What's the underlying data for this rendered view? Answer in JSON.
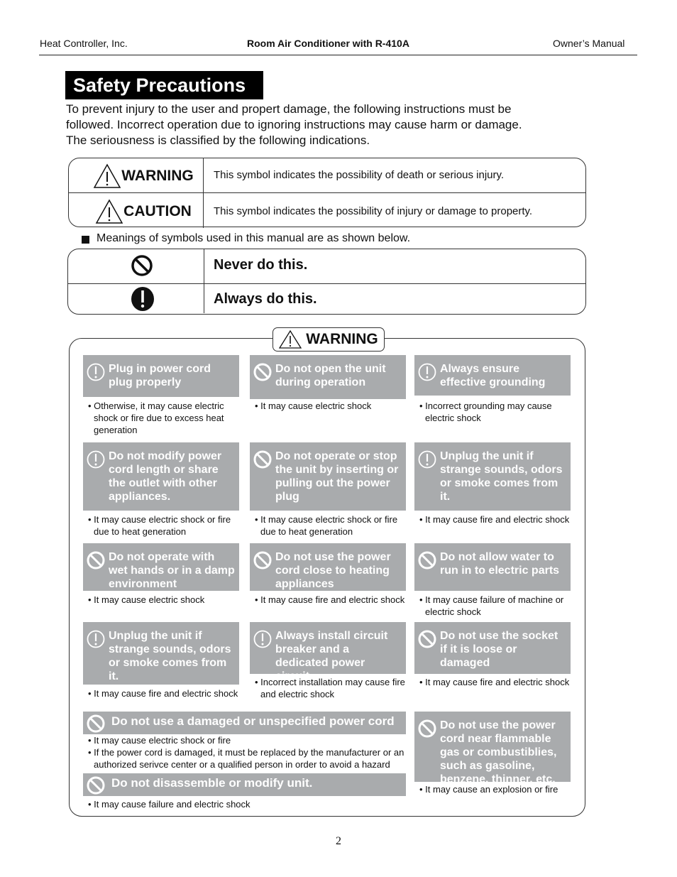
{
  "header": {
    "left": "Heat Controller, Inc.",
    "center": "Room Air Conditioner with R-410A",
    "right": "Owner’s Manual"
  },
  "title": "Safety Precautions",
  "intro": [
    "To prevent injury to the user and propert damage, the following instructions must be",
    "followed. Incorrect operation due to ignoring instructions may cause harm or damage.",
    "The seriousness is classified by the following indications."
  ],
  "severity_table": [
    {
      "icon": "warning-triangle-icon",
      "label": "WARNING",
      "description": "This symbol indicates the possibility of death or serious injury."
    },
    {
      "icon": "warning-triangle-icon",
      "label": "CAUTION",
      "description": "This symbol indicates the possibility of injury or damage to property."
    }
  ],
  "symbols_note": "Meanings of symbols used in this manual are as shown below.",
  "symbols_table": [
    {
      "icon": "prohibited-icon",
      "meaning": "Never do this."
    },
    {
      "icon": "mandatory-icon",
      "meaning": "Always do this."
    }
  ],
  "warning_section": {
    "badge": "WARNING",
    "cards": [
      {
        "icon": "mandatory",
        "title": "Plug in power cord plug properly",
        "notes": [
          "Otherwise, it may cause electric shock or fire due to excess heat generation"
        ]
      },
      {
        "icon": "prohibited",
        "title": "Do not open the unit during operation",
        "notes": [
          "It may cause electric shock"
        ]
      },
      {
        "icon": "mandatory",
        "title": "Always ensure effective grounding",
        "notes": [
          "Incorrect grounding may cause electric shock"
        ]
      },
      {
        "icon": "mandatory",
        "title": "Do not modify power cord length or share the outlet with other appliances.",
        "notes": [
          "It may cause electric shock or fire due to heat generation"
        ]
      },
      {
        "icon": "prohibited",
        "title": "Do not operate or stop the unit by inserting or pulling out the power plug",
        "notes": [
          "It may cause electric shock or fire due to heat generation"
        ]
      },
      {
        "icon": "mandatory",
        "title": "Unplug the unit if strange sounds, odors or smoke comes from it.",
        "notes": [
          "It may cause fire and electric shock"
        ]
      },
      {
        "icon": "prohibited",
        "title": "Do not operate with wet hands or in a damp environment",
        "notes": [
          "It may cause electric shock"
        ]
      },
      {
        "icon": "prohibited",
        "title": "Do not use the power cord close to heating appliances",
        "notes": [
          "It may cause fire and electric shock"
        ]
      },
      {
        "icon": "prohibited",
        "title": "Do not allow water to run in to electric parts",
        "notes": [
          "It may cause failure of machine or electric shock"
        ]
      },
      {
        "icon": "mandatory",
        "title": "Unplug the unit if strange sounds, odors or smoke comes from it.",
        "notes": [
          "It may cause fire and electric shock"
        ]
      },
      {
        "icon": "mandatory",
        "title": "Always install circuit breaker and a dedicated power circuit",
        "notes": [
          "Incorrect installation may cause fire and electric shock"
        ]
      },
      {
        "icon": "prohibited",
        "title": "Do not use the socket if it is loose or damaged",
        "notes": [
          "It may cause fire and electric shock"
        ]
      },
      {
        "icon": "prohibited",
        "title": "Do not use a damaged or unspecified power cord",
        "notes": [
          "It may cause electric shock or fire",
          "If the power cord is damaged, it must be replaced by the manufacturer or an authorized serivce center or a qualified person in order to avoid a hazard"
        ]
      },
      {
        "icon": "prohibited",
        "title": "Do not use the power cord near flammable gas or combustiblies, such as gasoline, benzene, thinner, etc.",
        "notes": [
          "It may cause an explosion or fire"
        ]
      },
      {
        "icon": "prohibited",
        "title": "Do not disassemble or modify unit.",
        "notes": [
          "It may cause failure and electric shock"
        ]
      }
    ]
  },
  "page_number": "2"
}
